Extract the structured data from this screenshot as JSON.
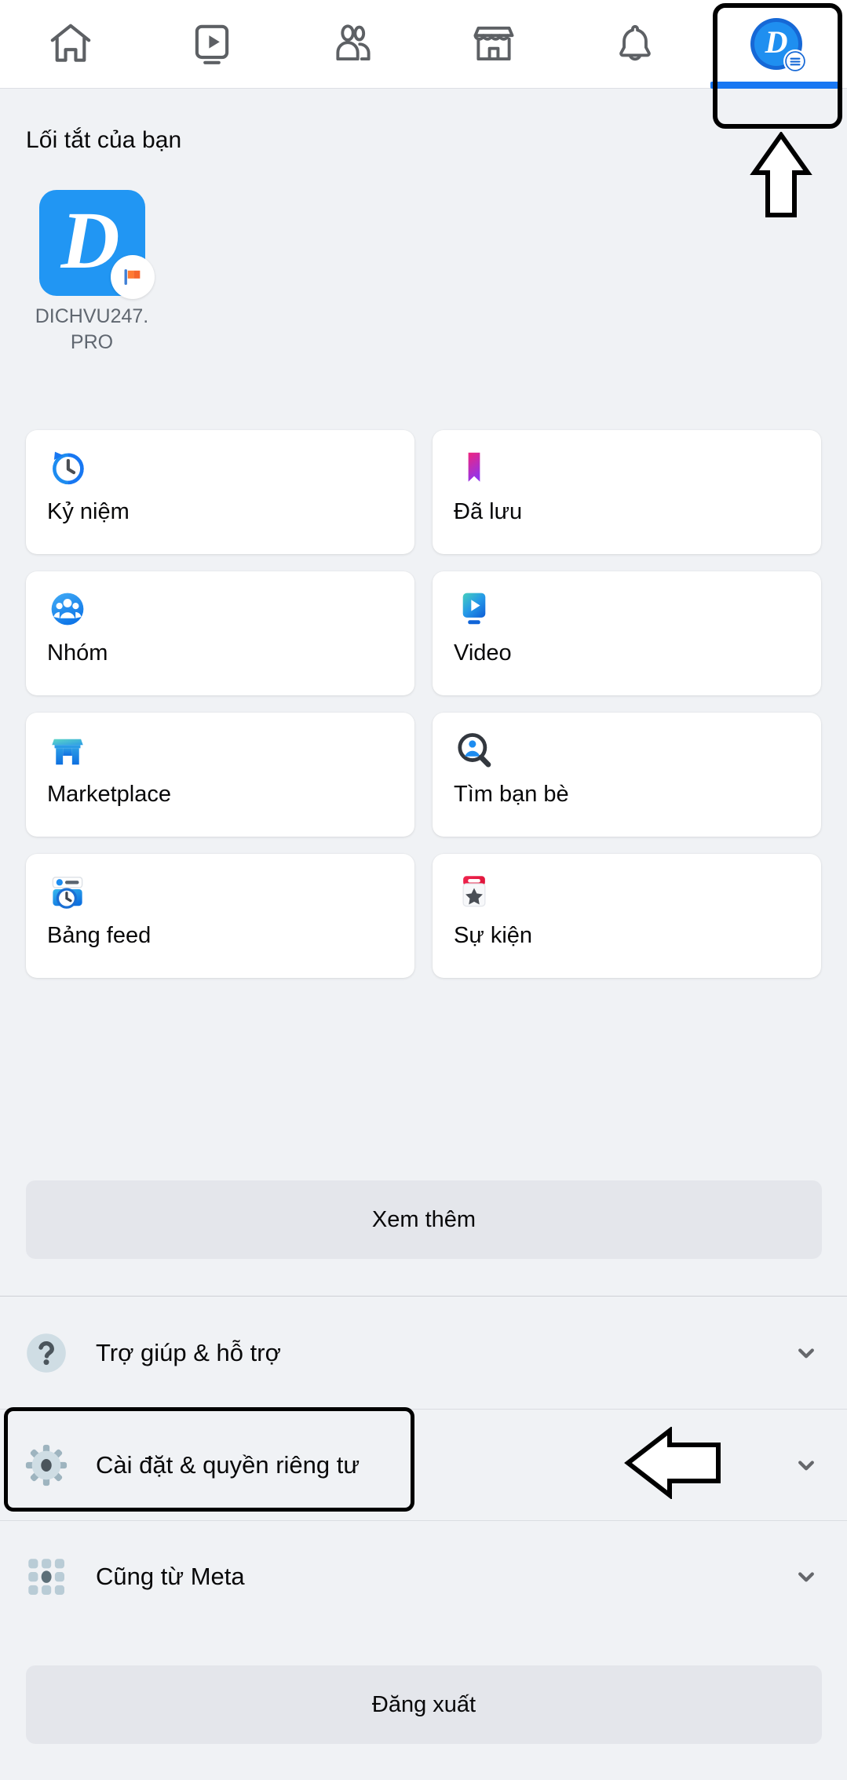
{
  "top_nav": {
    "tabs": [
      {
        "name": "home",
        "icon": "home-icon",
        "active": false
      },
      {
        "name": "video",
        "icon": "video-icon",
        "active": false
      },
      {
        "name": "friends",
        "icon": "friends-icon",
        "active": false
      },
      {
        "name": "marketplace",
        "icon": "marketplace-icon",
        "active": false
      },
      {
        "name": "notifications",
        "icon": "bell-icon",
        "active": false
      },
      {
        "name": "menu-profile",
        "icon": "profile-avatar-icon",
        "active": true
      }
    ]
  },
  "shortcuts_section": {
    "title": "Lối tắt của bạn",
    "items": [
      {
        "label": "DICHVU247.\nPRO",
        "letter": "D",
        "badge": "page-flag-icon",
        "tile_color": "#2196f3"
      }
    ]
  },
  "menu_grid": {
    "cards": [
      {
        "label": "Kỷ niệm",
        "icon": "memories-clock-icon"
      },
      {
        "label": "Đã lưu",
        "icon": "saved-bookmark-icon"
      },
      {
        "label": "Nhóm",
        "icon": "groups-icon"
      },
      {
        "label": "Video",
        "icon": "video-play-icon"
      },
      {
        "label": "Marketplace",
        "icon": "marketplace-shop-icon"
      },
      {
        "label": "Tìm bạn bè",
        "icon": "find-friends-search-icon"
      },
      {
        "label": "Bảng feed",
        "icon": "feeds-icon"
      },
      {
        "label": "Sự kiện",
        "icon": "events-calendar-icon"
      }
    ],
    "see_more_label": "Xem thêm"
  },
  "settings_list": {
    "rows": [
      {
        "label": "Trợ giúp & hỗ trợ",
        "icon": "question-mark-icon",
        "chevron": "chevron-down-icon"
      },
      {
        "label": "Cài đặt & quyền riêng tư",
        "icon": "gear-icon",
        "chevron": "chevron-down-icon"
      },
      {
        "label": "Cũng từ Meta",
        "icon": "meta-apps-grid-icon",
        "chevron": "chevron-down-icon"
      }
    ]
  },
  "footer": {
    "logout_label": "Đăng xuất"
  },
  "annotations": [
    {
      "name": "avatar-highlight-box",
      "shape": "rounded-rect",
      "color": "#000000"
    },
    {
      "name": "avatar-arrow-up",
      "shape": "arrow-up",
      "color": "#000000"
    },
    {
      "name": "settings-highlight-box",
      "shape": "rounded-rect",
      "color": "#000000"
    },
    {
      "name": "settings-arrow-left",
      "shape": "arrow-left",
      "color": "#000000"
    }
  ],
  "colors": {
    "page_bg": "#f0f2f5",
    "card_bg": "#ffffff",
    "accent_blue": "#1877f2",
    "button_bg": "#e4e6eb",
    "text_primary": "#080809",
    "text_secondary": "#606770"
  }
}
